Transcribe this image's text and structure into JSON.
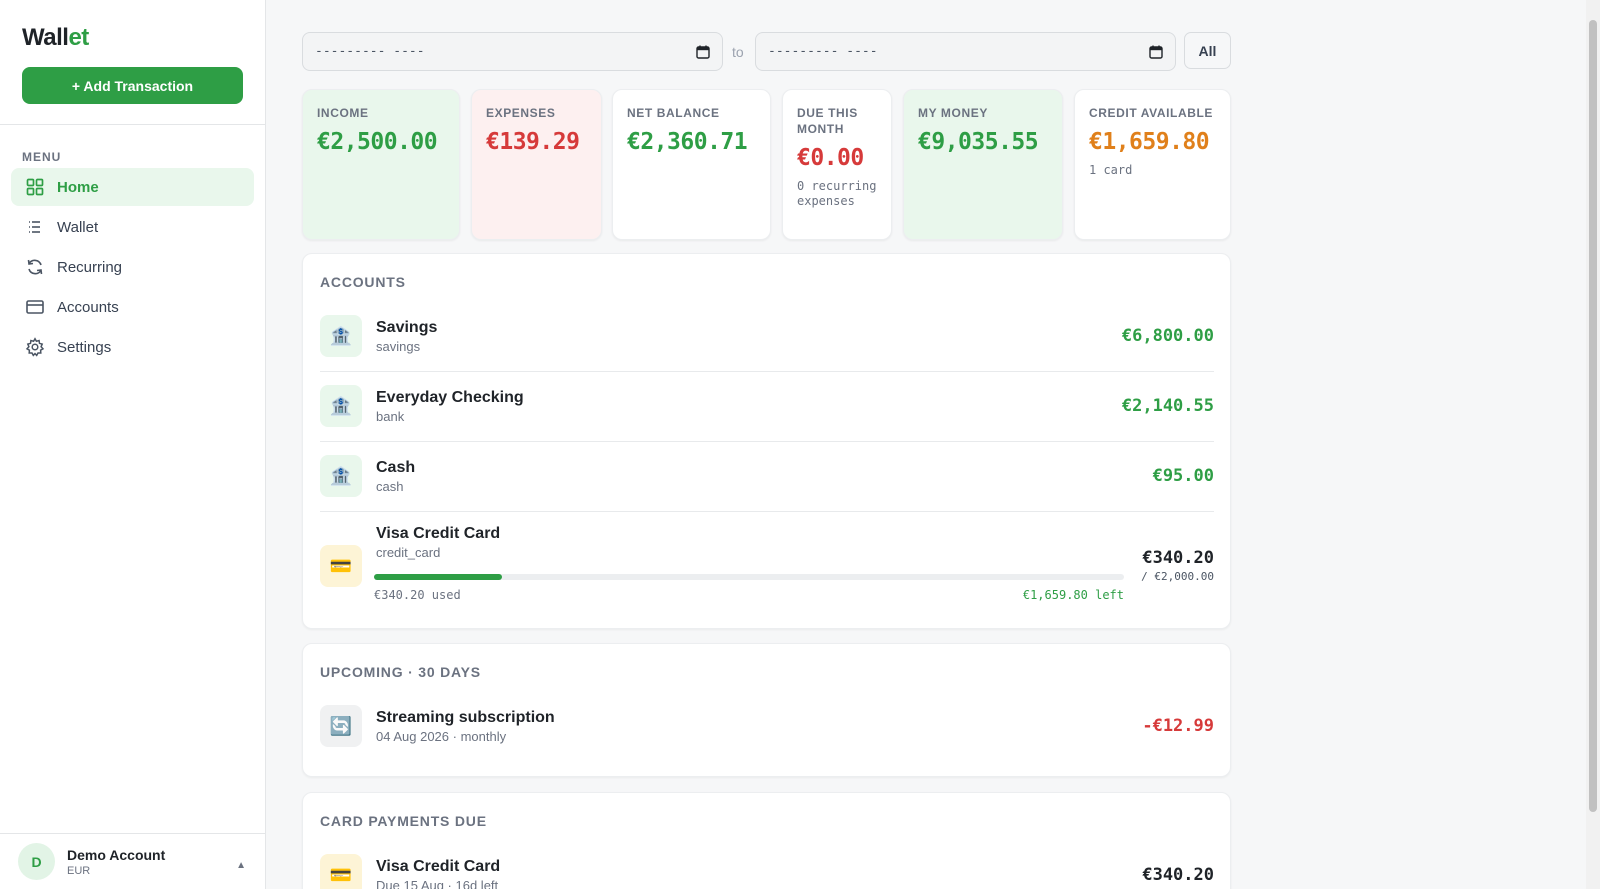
{
  "sidebar": {
    "brand_part1": "Wall",
    "brand_part2": "et",
    "add_button": "+ Add Transaction",
    "menu_label": "MENU",
    "items": [
      {
        "label": "Home",
        "icon": "grid-icon",
        "active": true
      },
      {
        "label": "Wallet",
        "icon": "list-icon"
      },
      {
        "label": "Recurring",
        "icon": "refresh-icon"
      },
      {
        "label": "Accounts",
        "icon": "credit-card-icon"
      },
      {
        "label": "Settings",
        "icon": "gear-icon"
      }
    ],
    "account": {
      "initial": "D",
      "name": "Demo Account",
      "currency": "EUR",
      "caret": "▲"
    }
  },
  "filters": {
    "from_placeholder": "--------- ----",
    "to_label": "to",
    "to_placeholder": "--------- ----",
    "all_button": "All"
  },
  "stats": [
    {
      "label": "INCOME",
      "value": "€2,500.00",
      "color": "#2e9e45"
    },
    {
      "label": "EXPENSES",
      "value": "€139.29",
      "color": "#d63a3a"
    },
    {
      "label": "NET BALANCE",
      "value": "€2,360.71",
      "color": "#2e9e45"
    },
    {
      "label": "DUE THIS MONTH",
      "value": "€0.00",
      "sub": "0 recurring expenses",
      "color": "#d63a3a"
    },
    {
      "label": "MY MONEY",
      "value": "€9,035.55",
      "color": "#2e9e45"
    },
    {
      "label": "CREDIT AVAILABLE",
      "value": "€1,659.80",
      "sub": "1 card",
      "color": "#e0801b"
    }
  ],
  "accounts": {
    "title": "ACCOUNTS",
    "rows": [
      {
        "name": "Savings",
        "type": "savings",
        "amount": "€6,800.00",
        "icon": "bank-icon"
      },
      {
        "name": "Everyday Checking",
        "type": "bank",
        "amount": "€2,140.55",
        "icon": "bank-icon"
      },
      {
        "name": "Cash",
        "type": "cash",
        "amount": "€95.00",
        "icon": "bank-icon"
      }
    ],
    "card": {
      "name": "Visa Credit Card",
      "type": "credit_card",
      "amount": "€340.20",
      "limit": "/ €2,000.00",
      "used_text": "€340.20 used",
      "left_text": "€1,659.80 left",
      "used_fraction": 0.17,
      "icon": "credit-card-icon"
    }
  },
  "upcoming": {
    "title": "UPCOMING · 30 DAYS",
    "rows": [
      {
        "name": "Streaming subscription",
        "sub": "04 Aug 2026 · monthly",
        "amount": "-€12.99",
        "icon": "recurring-icon"
      }
    ]
  },
  "card_payments": {
    "title": "CARD PAYMENTS DUE",
    "rows": [
      {
        "name": "Visa Credit Card",
        "sub": "Due 15 Aug · 16d left",
        "amount": "€340.20",
        "icon": "credit-card-icon"
      }
    ]
  },
  "icons": {
    "bank": "🏦",
    "card": "💳",
    "recurring": "🔄"
  }
}
